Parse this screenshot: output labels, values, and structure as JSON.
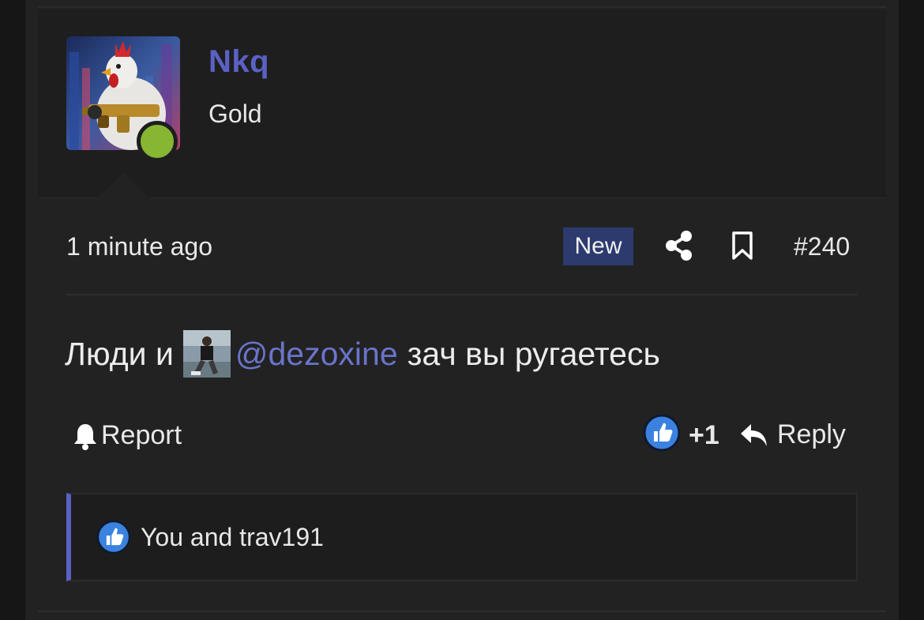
{
  "user": {
    "name": "Nkq",
    "title": "Gold",
    "online": true,
    "avatar_icon": "chicken-with-gun-avatar"
  },
  "post": {
    "time": "1 minute ago",
    "badge": "New",
    "number": "#240",
    "message": {
      "before": "Люди и",
      "mention": "@dezoxine",
      "after": "зач вы ругаетесь"
    }
  },
  "actions": {
    "report": "Report",
    "like_count": "+1",
    "reply": "Reply"
  },
  "reactions": {
    "text": "You and trav191"
  },
  "colors": {
    "accent": "#5b61c4",
    "online": "#86b632",
    "badge_bg": "#2c3a6e",
    "background": "#222223"
  }
}
